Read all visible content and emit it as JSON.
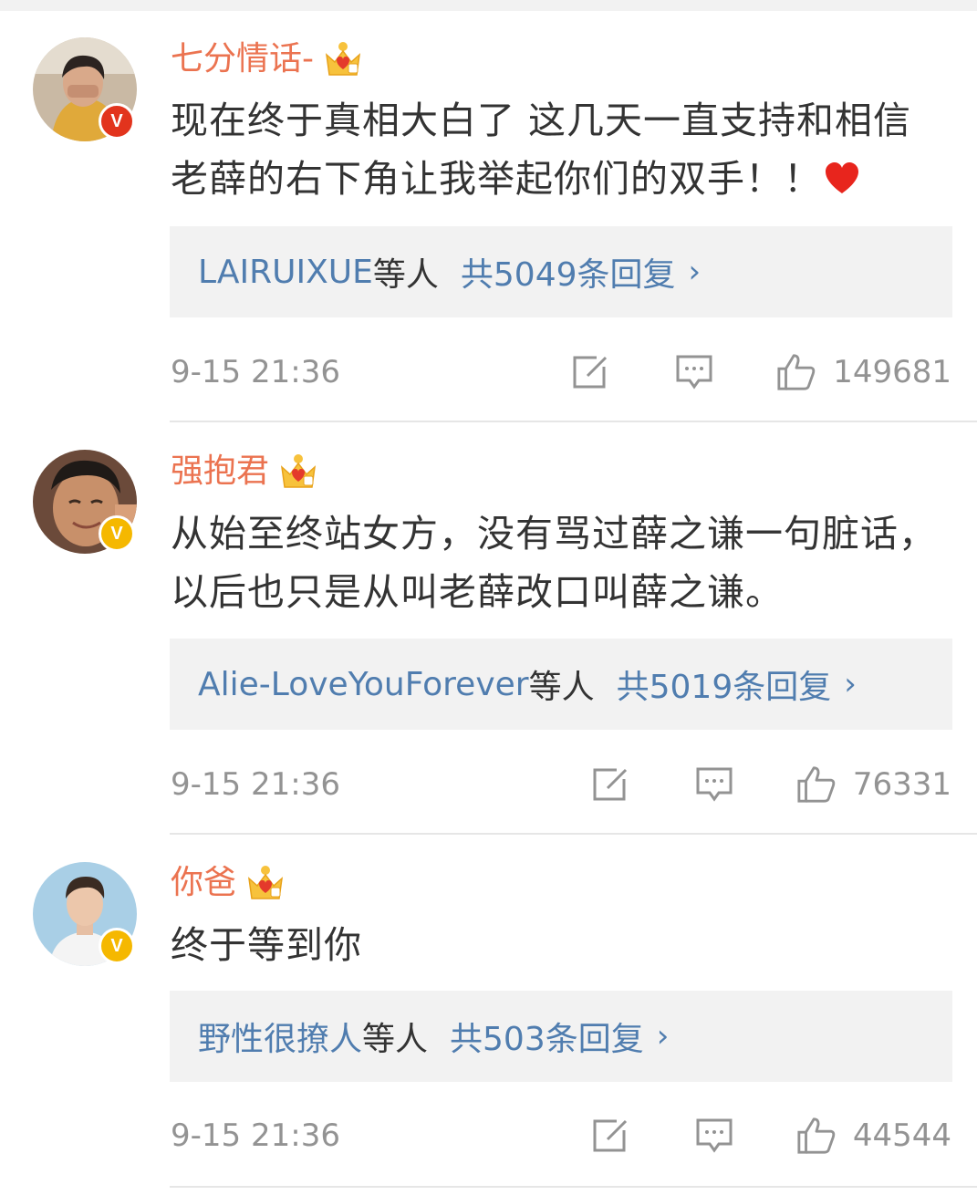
{
  "colors": {
    "username": "#eb7350",
    "link": "#507daf",
    "meta": "#939393",
    "text": "#333333",
    "reply_bg": "#f2f2f2",
    "verified_red": "#e2341d",
    "verified_yellow": "#f5b800"
  },
  "comments": [
    {
      "username": "七分情话-",
      "badge_icon": "crown-icon",
      "verified": "red",
      "verified_mark": "V",
      "text": "现在终于真相大白了  这几天一直支持和相信老薛的右下角让我举起你们的双手！！",
      "text_emoji": "heart-icon",
      "reply_names": "LAIRUIXUE",
      "reply_etc": "等人",
      "reply_total": "共5049条回复",
      "reply_chevron": "›",
      "timestamp": "9-15 21:36",
      "likes": "149681"
    },
    {
      "username": "强抱君",
      "badge_icon": "crown-icon",
      "verified": "yellow",
      "verified_mark": "V",
      "text": "从始至终站女方，没有骂过薛之谦一句脏话，以后也只是从叫老薛改口叫薛之谦。",
      "reply_names": "Alie-LoveYouForever",
      "reply_etc": "等人",
      "reply_total": "共5019条回复",
      "reply_chevron": "›",
      "timestamp": "9-15 21:36",
      "likes": "76331"
    },
    {
      "username": "你爸",
      "badge_icon": "crown-icon",
      "verified": "yellow",
      "verified_mark": "V",
      "text": "终于等到你",
      "reply_names": "野性很撩人",
      "reply_etc": "等人",
      "reply_total": "共503条回复",
      "reply_chevron": "›",
      "timestamp": "9-15 21:36",
      "likes": "44544"
    }
  ]
}
